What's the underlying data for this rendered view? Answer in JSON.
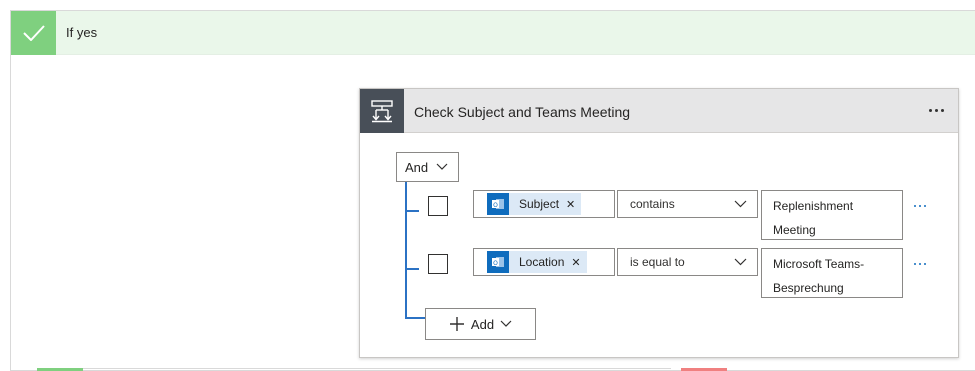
{
  "branch": {
    "title": "If yes"
  },
  "condition": {
    "title": "Check Subject and Teams Meeting",
    "operator": "And",
    "rows": [
      {
        "field": "Subject",
        "operator": "contains",
        "value_line1": "Replenishment",
        "value_line2": "Meeting"
      },
      {
        "field": "Location",
        "operator": "is equal to",
        "value_line1": "Microsoft Teams-",
        "value_line2": "Besprechung"
      }
    ],
    "add_label": "Add"
  },
  "icons": {
    "branch_status": "checkmark-icon",
    "condition": "condition-icon",
    "token": "outlook-icon",
    "remove": "close-icon",
    "dropdown": "chevron-down-icon",
    "add": "plus-icon",
    "more": "more-icon"
  },
  "colors": {
    "branch_yes": "#7fd07f",
    "branch_header_bg": "#eaf7ea",
    "condition_icon_bg": "#484f58",
    "accent": "#0f6cbd",
    "token_bg": "#dce9f6",
    "tree_line": "#2b72c4",
    "branch_no": "#f08080"
  }
}
